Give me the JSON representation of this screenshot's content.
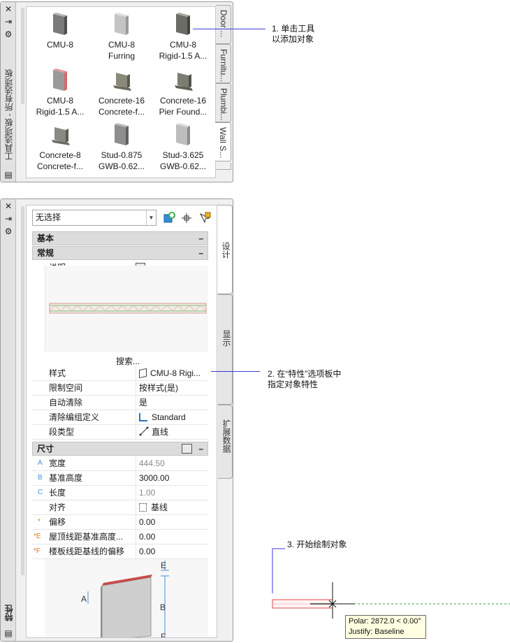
{
  "tool_palette": {
    "title": "工具选项板 - 所有选项板",
    "tools": [
      {
        "line1": "CMU-8",
        "line2": ""
      },
      {
        "line1": "CMU-8",
        "line2": "Furring"
      },
      {
        "line1": "CMU-8",
        "line2": "Rigid-1.5 A..."
      },
      {
        "line1": "CMU-8",
        "line2": "Rigid-1.5 A..."
      },
      {
        "line1": "Concrete-16",
        "line2": "Concrete-f..."
      },
      {
        "line1": "Concrete-16",
        "line2": "Pier Found..."
      },
      {
        "line1": "Concrete-8",
        "line2": "Concrete-f..."
      },
      {
        "line1": "Stud-0.875",
        "line2": "GWB-0.62..."
      },
      {
        "line1": "Stud-3.625",
        "line2": "GWB-0.62..."
      }
    ],
    "tabs": [
      "Door ...",
      "Furnitu...",
      "Plumbi...",
      "Wall S..."
    ],
    "active_tab": "Wall S..."
  },
  "properties": {
    "title": "特性",
    "selection": "无选择",
    "tabs": [
      "设计",
      "显示",
      "扩展数据"
    ],
    "sections": {
      "basic": "基本",
      "general": "常规",
      "dimensions": "尺寸"
    },
    "collapse_symbol": "–",
    "description_label": "说明",
    "search_label": "搜索...",
    "general_rows": [
      {
        "label": "样式",
        "value": "CMU-8 Rigi..."
      },
      {
        "label": "限制空间",
        "value": "按样式(是)"
      },
      {
        "label": "自动清除",
        "value": "是"
      },
      {
        "label": "清除编组定义",
        "value": "Standard"
      },
      {
        "label": "段类型",
        "value": "直线"
      }
    ],
    "dimension_rows": [
      {
        "letter": "A",
        "label": "宽度",
        "value": "444.50",
        "dim": true
      },
      {
        "letter": "B",
        "label": "基准高度",
        "value": "3000.00",
        "dim": false
      },
      {
        "letter": "C",
        "label": "长度",
        "value": "1.00",
        "dim": true
      },
      {
        "letter": "",
        "label": "对齐",
        "value": "基线",
        "dim": false
      },
      {
        "letter": "*",
        "label": "偏移",
        "value": "0.00",
        "dim": false
      },
      {
        "letter": "*E",
        "label": "屋顶线距基准高度...",
        "value": "0.00",
        "dim": false
      },
      {
        "letter": "*F",
        "label": "楼板线距基线的偏移",
        "value": "0.00",
        "dim": false
      }
    ],
    "diagram_labels": [
      "A",
      "B",
      "E",
      "F"
    ]
  },
  "callouts": {
    "step1_line1": "1.  单击工具",
    "step1_line2": "以添加对象",
    "step2_line1": "2.  在“特性”选项板中",
    "step2_line2": "指定对象特性",
    "step3": "3.  开始绘制对象"
  },
  "tooltip": {
    "line1": "Polar: 2872.0 < 0.00°",
    "line2": "Justify: Baseline"
  },
  "colors": {
    "callout_line": "#3b3bd9",
    "wall_red": "#e04848",
    "tracking_green": "#3a9a3a"
  }
}
